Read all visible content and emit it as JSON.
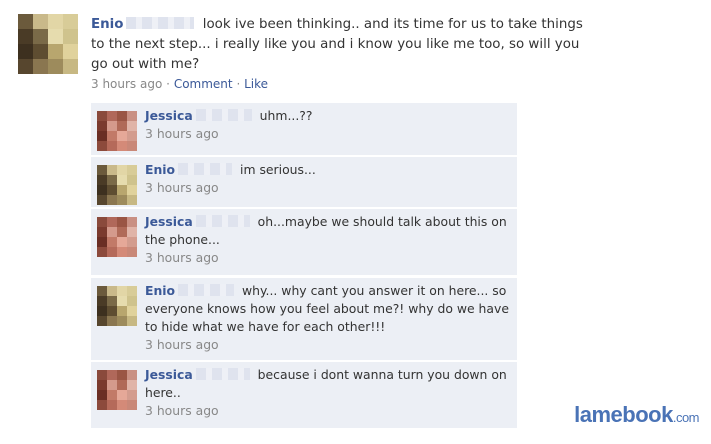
{
  "post": {
    "author": "Enio",
    "text": "look ive been thinking.. and its time for us to take things to the next step... i really like you and i know you like me too, so will you go out with me?",
    "time": "3 hours ago",
    "comment_link": "Comment",
    "like_link": "Like",
    "separator": "·"
  },
  "comments": [
    {
      "author": "Jessica",
      "text": "uhm...??",
      "time": "3 hours ago"
    },
    {
      "author": "Enio",
      "text": "im serious...",
      "time": "3 hours ago"
    },
    {
      "author": "Jessica",
      "text": "oh...maybe we should talk about this on the phone...",
      "time": "3 hours ago"
    },
    {
      "author": "Enio",
      "text": "why... why cant you answer it on here... so everyone knows how you feel about me?! why do we have to hide what we have for each other!!!",
      "time": "3 hours ago"
    },
    {
      "author": "Jessica",
      "text": "because i dont wanna turn you down on here..",
      "time": "3 hours ago"
    }
  ],
  "watermark": {
    "brand": "lamebook",
    "domain": ".com"
  },
  "colors": {
    "link": "#3b5998",
    "comment_bg": "#eceff5",
    "muted": "#888888",
    "watermark": "#4a73b6"
  }
}
